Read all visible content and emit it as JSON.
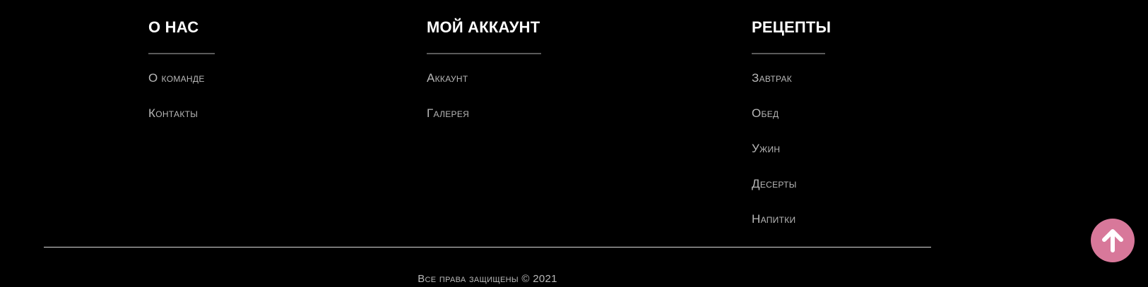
{
  "colors": {
    "background": "#000000",
    "heading": "#ffffff",
    "link": "#b8b8b8",
    "underline": "#5a5a5a",
    "divider": "#d9d9d9",
    "scroll_button": "#d8789a"
  },
  "footer": {
    "columns": [
      {
        "title": "О НАС",
        "links": [
          "О команде",
          "Контакты"
        ]
      },
      {
        "title": "МОЙ АККАУНТ",
        "links": [
          "Аккаунт",
          "Галерея"
        ]
      },
      {
        "title": "РЕЦЕПТЫ",
        "links": [
          "Завтрак",
          "Обед",
          "Ужин",
          "Десерты",
          "Напитки"
        ]
      }
    ],
    "copyright": "Все права защищены © 2021"
  },
  "scroll_top": {
    "icon": "arrow-up-icon"
  }
}
